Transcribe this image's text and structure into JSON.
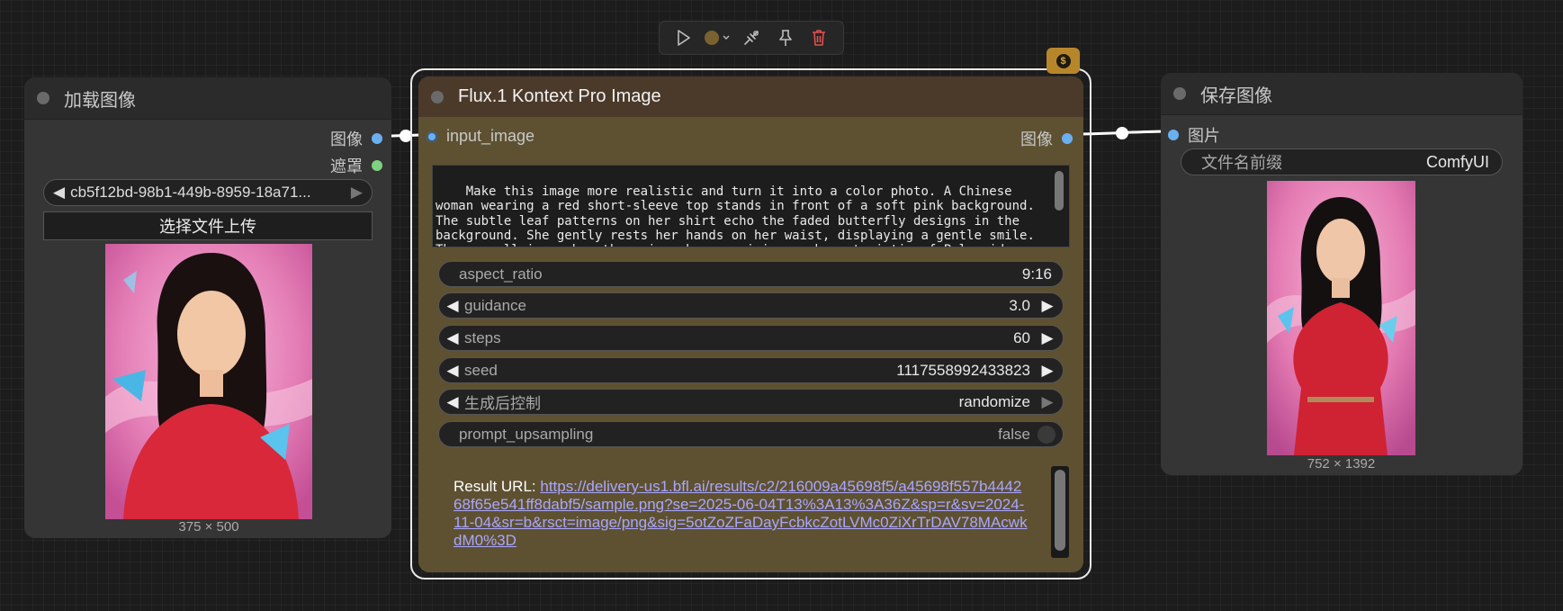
{
  "toolbar": {
    "buttons": [
      "play-icon",
      "color-picker",
      "bypass-icon",
      "pin-icon",
      "delete-icon"
    ],
    "node_color": "#7a6230",
    "delete_color": "#e05050"
  },
  "load_node": {
    "title": "加载图像",
    "outputs": [
      {
        "label": "图像",
        "color": "#6ab0f0"
      },
      {
        "label": "遮罩",
        "color": "#7fd07f"
      }
    ],
    "file_value": "cb5f12bd-98b1-449b-8959-18a71...",
    "upload_label": "选择文件上传",
    "dims": "375 × 500"
  },
  "flux_node": {
    "title": "Flux.1 Kontext Pro Image",
    "input_label": "input_image",
    "output_label": "图像",
    "badge": "$",
    "prompt": "Make this image more realistic and turn it into a color photo. A Chinese woman wearing a red short-sleeve top stands in front of a soft pink background. The subtle leaf patterns on her shirt echo the faded butterfly designs in the background. She gently rests her hands on her waist, displaying a gentle smile. The overall image has the unique hazy graininess characteristic of Polaroid film.Change the clothes to be a viking warrior",
    "widgets": [
      {
        "label": "aspect_ratio",
        "value": "9:16",
        "arrows": false
      },
      {
        "label": "guidance",
        "value": "3.0",
        "arrows": true
      },
      {
        "label": "steps",
        "value": "60",
        "arrows": true
      },
      {
        "label": "seed",
        "value": "1117558992433823",
        "arrows": true
      },
      {
        "label": "生成后控制",
        "value": "randomize",
        "arrows": true
      }
    ],
    "toggle": {
      "label": "prompt_upsampling",
      "value": "false"
    },
    "result_label": "Result URL:",
    "result_url": "https://delivery-us1.bfl.ai/results/c2/216009a45698f5/a45698f557b444268f65e541ff8dabf5/sample.png?se=2025-06-04T13%3A13%3A36Z&sp=r&sv=2024-11-04&sr=b&rsct=image/png&sig=5otZoZFaDayFcbkcZotLVMc0ZiXrTrDAV78MAcwkdM0%3D"
  },
  "save_node": {
    "title": "保存图像",
    "input_label": "图片",
    "prefix_label": "文件名前缀",
    "prefix_value": "ComfyUI",
    "dims": "752 × 1392"
  }
}
